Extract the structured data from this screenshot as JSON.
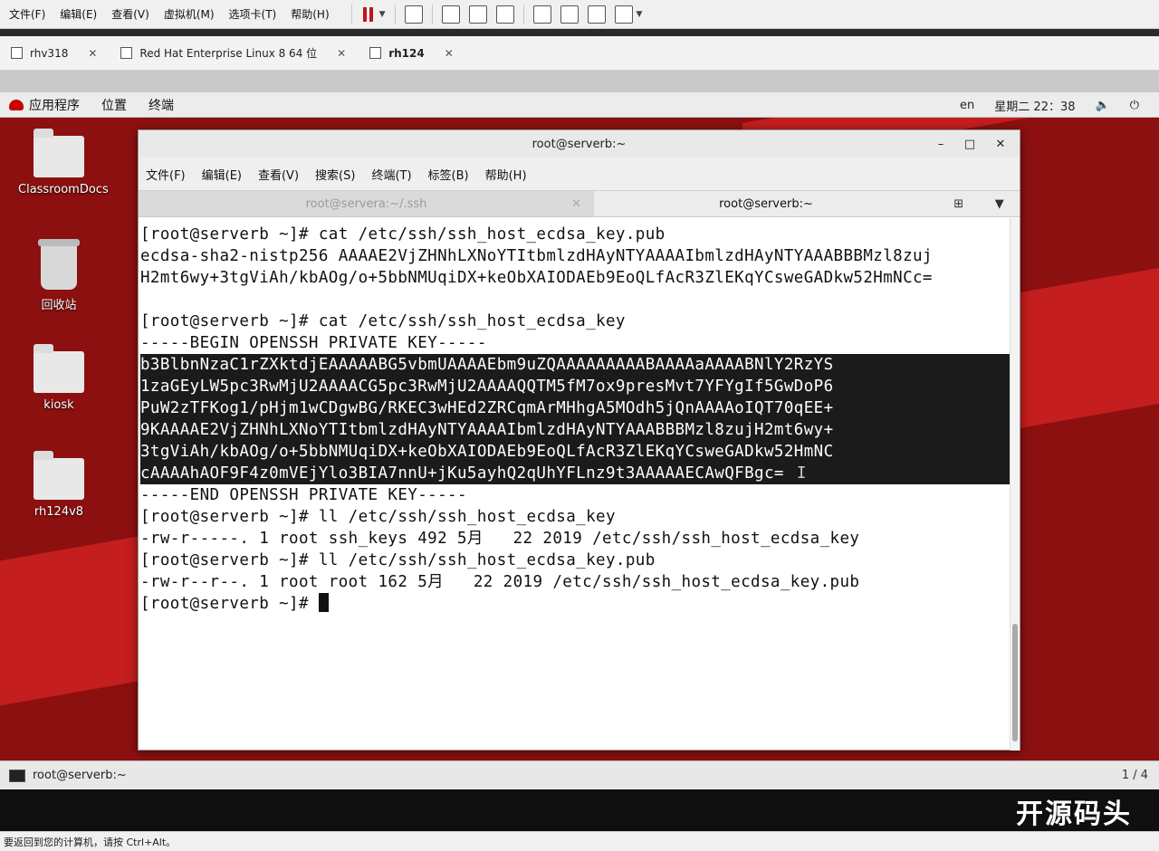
{
  "host_menu": [
    "文件(F)",
    "编辑(E)",
    "查看(V)",
    "虚拟机(M)",
    "选项卡(T)",
    "帮助(H)"
  ],
  "vm_tabs": [
    {
      "label": "rhv318"
    },
    {
      "label": "Red Hat Enterprise Linux 8 64 位"
    },
    {
      "label": "rh124"
    }
  ],
  "gnome": {
    "menu": [
      "应用程序",
      "位置",
      "终端"
    ],
    "lang": "en",
    "clock": "星期二 22：38"
  },
  "desktop_icons": [
    {
      "label": "ClassroomDocs"
    },
    {
      "label": "回收站"
    },
    {
      "label": "kiosk"
    },
    {
      "label": "rh124v8"
    }
  ],
  "terminal": {
    "title": "root@serverb:~",
    "menu": [
      "文件(F)",
      "编辑(E)",
      "查看(V)",
      "搜索(S)",
      "终端(T)",
      "标签(B)",
      "帮助(H)"
    ],
    "tabs": [
      {
        "label": "root@servera:~/.ssh"
      },
      {
        "label": "root@serverb:~"
      }
    ],
    "lines": [
      "[root@serverb ~]# cat /etc/ssh/ssh_host_ecdsa_key.pub",
      "ecdsa-sha2-nistp256 AAAAE2VjZHNhLXNoYTItbmlzdHAyNTYAAAAIbmlzdHAyNTYAAABBBMzl8zuj",
      "H2mt6wy+3tgViAh/kbAOg/o+5bbNMUqiDX+keObXAIODAEb9EoQLfAcR3ZlEKqYCsweGADkw52HmNCc=",
      "",
      "[root@serverb ~]# cat /etc/ssh/ssh_host_ecdsa_key",
      "-----BEGIN OPENSSH PRIVATE KEY-----",
      "b3BlbnNzaC1rZXktdjEAAAAABG5vbmUAAAAEbm9uZQAAAAAAAAABAAAAaAAAABNlY2RzYS",
      "1zaGEyLW5pc3RwMjU2AAAACG5pc3RwMjU2AAAAQQTM5fM7ox9presMvt7YFYgIf5GwDoP6",
      "PuW2zTFKog1/pHjm1wCDgwBG/RKEC3wHEd2ZRCqmArMHhgA5MOdh5jQnAAAAoIQT70qEE+",
      "9KAAAAE2VjZHNhLXNoYTItbmlzdHAyNTYAAAAIbmlzdHAyNTYAAABBBMzl8zujH2mt6wy+",
      "3tgViAh/kbAOg/o+5bbNMUqiDX+keObXAIODAEb9EoQLfAcR3ZlEKqYCsweGADkw52HmNC",
      "cAAAAhAOF9F4z0mVEjYlo3BIA7nnU+jKu5ayhQ2qUhYFLnz9t3AAAAAECAwQFBgc=",
      "-----END OPENSSH PRIVATE KEY-----",
      "[root@serverb ~]# ll /etc/ssh/ssh_host_ecdsa_key",
      "-rw-r-----. 1 root ssh_keys 492 5月   22 2019 /etc/ssh/ssh_host_ecdsa_key",
      "[root@serverb ~]# ll /etc/ssh/ssh_host_ecdsa_key.pub",
      "-rw-r--r--. 1 root root 162 5月   22 2019 /etc/ssh/ssh_host_ecdsa_key.pub",
      "[root@serverb ~]# "
    ]
  },
  "taskbar": {
    "window_label": "root@serverb:~",
    "workspace": "1 / 4"
  },
  "watermark": "开源码头",
  "statusbar": "要返回到您的计算机，请按 Ctrl+Alt。"
}
